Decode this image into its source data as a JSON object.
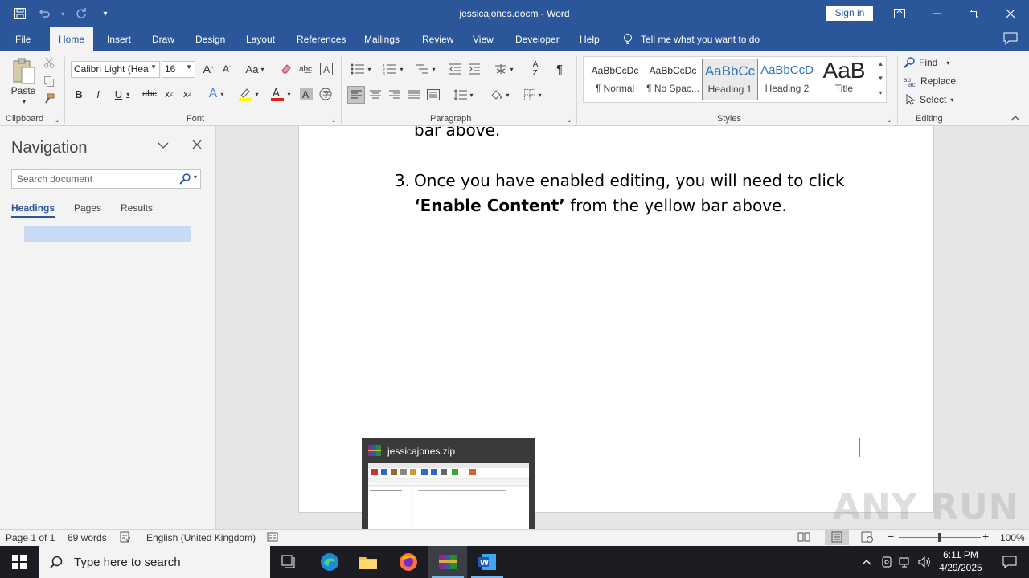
{
  "titlebar": {
    "title": "jessicajones.docm  -  Word",
    "sign_in": "Sign in"
  },
  "tabs": [
    "File",
    "Home",
    "Insert",
    "Draw",
    "Design",
    "Layout",
    "References",
    "Mailings",
    "Review",
    "View",
    "Developer",
    "Help"
  ],
  "active_tab": "Home",
  "tell_me": "Tell me what you want to do",
  "ribbon": {
    "clipboard": {
      "paste": "Paste",
      "label": "Clipboard"
    },
    "font": {
      "name": "Calibri Light (Hea",
      "size": "16",
      "label": "Font"
    },
    "paragraph": {
      "label": "Paragraph"
    },
    "styles": {
      "label": "Styles",
      "items": [
        {
          "preview": "AaBbCcDc",
          "name": "¶ Normal"
        },
        {
          "preview": "AaBbCcDc",
          "name": "¶ No Spac..."
        },
        {
          "preview": "AaBbCc",
          "name": "Heading 1"
        },
        {
          "preview": "AaBbCcD",
          "name": "Heading 2"
        },
        {
          "preview": "AaB",
          "name": "Title"
        }
      ]
    },
    "editing": {
      "find": "Find",
      "replace": "Replace",
      "select": "Select",
      "label": "Editing"
    }
  },
  "nav": {
    "title": "Navigation",
    "search_placeholder": "Search document",
    "tabs": [
      "Headings",
      "Pages",
      "Results"
    ]
  },
  "document": {
    "line_top": "bar above.",
    "item_number": "3.",
    "item_line1": "Once you have enabled editing, you will need to click",
    "item_bold": "‘Enable Content’",
    "item_rest": " from the yellow bar above."
  },
  "thumbnail": {
    "title": "jessicajones.zip"
  },
  "status": {
    "page": "Page 1 of 1",
    "words": "69 words",
    "language": "English (United Kingdom)",
    "zoom": "100%"
  },
  "taskbar": {
    "search_placeholder": "Type here to search",
    "time": "6:11 PM",
    "date": "4/29/2025"
  },
  "watermark": "ANY RUN",
  "colors": {
    "word_blue": "#2b579a",
    "ribbon_bg": "#f3f3f3",
    "taskbar": "#1b1d22"
  }
}
